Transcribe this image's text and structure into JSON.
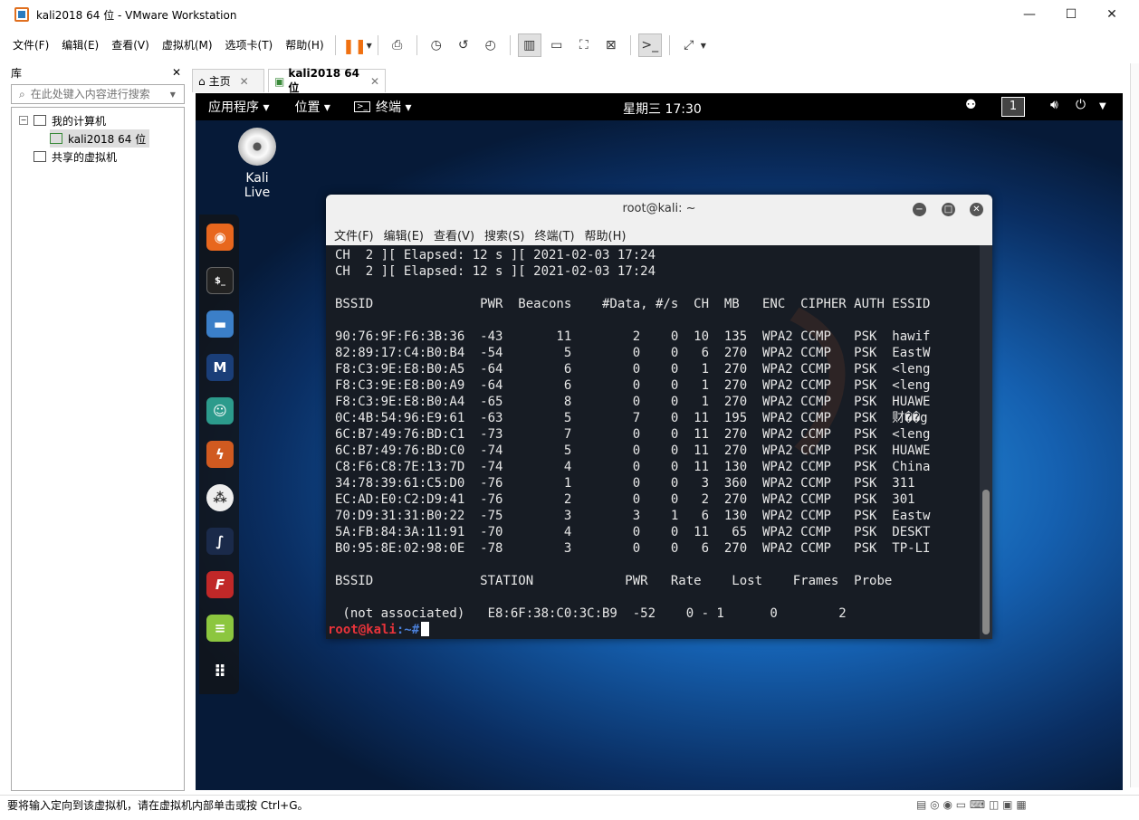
{
  "window": {
    "title": "kali2018 64 位 - VMware Workstation",
    "min": "—",
    "max": "☐",
    "close": "✕"
  },
  "menu": [
    "文件(F)",
    "编辑(E)",
    "查看(V)",
    "虚拟机(M)",
    "选项卡(T)",
    "帮助(H)"
  ],
  "library": {
    "title": "库",
    "close": "✕",
    "search_placeholder": "在此处键入内容进行搜索",
    "my_computer": "我的计算机",
    "vm_name": "kali2018 64 位",
    "shared": "共享的虚拟机"
  },
  "tabs": [
    {
      "label": "主页"
    },
    {
      "label": "kali2018 64 位"
    }
  ],
  "kali": {
    "apps": "应用程序 ▾",
    "places": "位置 ▾",
    "terminal": "终端 ▾",
    "clock": "星期三 17:30",
    "workspace": "1",
    "desktop_icon": "Kali Live"
  },
  "terminal": {
    "title": "root@kali: ~",
    "menu": [
      "文件(F)",
      "编辑(E)",
      "查看(V)",
      "搜索(S)",
      "终端(T)",
      "帮助(H)"
    ],
    "lines": [
      "CH  2 ][ Elapsed: 12 s ][ 2021-02-03 17:24",
      "CH  2 ][ Elapsed: 12 s ][ 2021-02-03 17:24",
      "",
      "BSSID              PWR  Beacons    #Data, #/s  CH  MB   ENC  CIPHER AUTH ESSID",
      "",
      "90:76:9F:F6:3B:36  -43       11        2    0  10  135  WPA2 CCMP   PSK  hawif",
      "82:89:17:C4:B0:B4  -54        5        0    0   6  270  WPA2 CCMP   PSK  EastW",
      "F8:C3:9E:E8:B0:A5  -64        6        0    0   1  270  WPA2 CCMP   PSK  <leng",
      "F8:C3:9E:E8:B0:A9  -64        6        0    0   1  270  WPA2 CCMP   PSK  <leng",
      "F8:C3:9E:E8:B0:A4  -65        8        0    0   1  270  WPA2 CCMP   PSK  HUAWE",
      "0C:4B:54:96:E9:61  -63        5        7    0  11  195  WPA2 CCMP   PSK  财��g",
      "6C:B7:49:76:BD:C1  -73        7        0    0  11  270  WPA2 CCMP   PSK  <leng",
      "6C:B7:49:76:BD:C0  -74        5        0    0  11  270  WPA2 CCMP   PSK  HUAWE",
      "C8:F6:C8:7E:13:7D  -74        4        0    0  11  130  WPA2 CCMP   PSK  China",
      "34:78:39:61:C5:D0  -76        1        0    0   3  360  WPA2 CCMP   PSK  311",
      "EC:AD:E0:C2:D9:41  -76        2        0    0   2  270  WPA2 CCMP   PSK  301",
      "70:D9:31:31:B0:22  -75        3        3    1   6  130  WPA2 CCMP   PSK  Eastw",
      "5A:FB:84:3A:11:91  -70        4        0    0  11   65  WPA2 CCMP   PSK  DESKT",
      "B0:95:8E:02:98:0E  -78        3        0    0   6  270  WPA2 CCMP   PSK  TP-LI",
      "",
      "BSSID              STATION            PWR   Rate    Lost    Frames  Probe",
      "",
      " (not associated)   E8:6F:38:C0:3C:B9  -52    0 - 1      0        2"
    ],
    "prompt_user": "root@kali",
    "prompt_path": ":~#"
  },
  "status": "要将输入定向到该虚拟机，请在虚拟机内部单击或按 Ctrl+G。"
}
